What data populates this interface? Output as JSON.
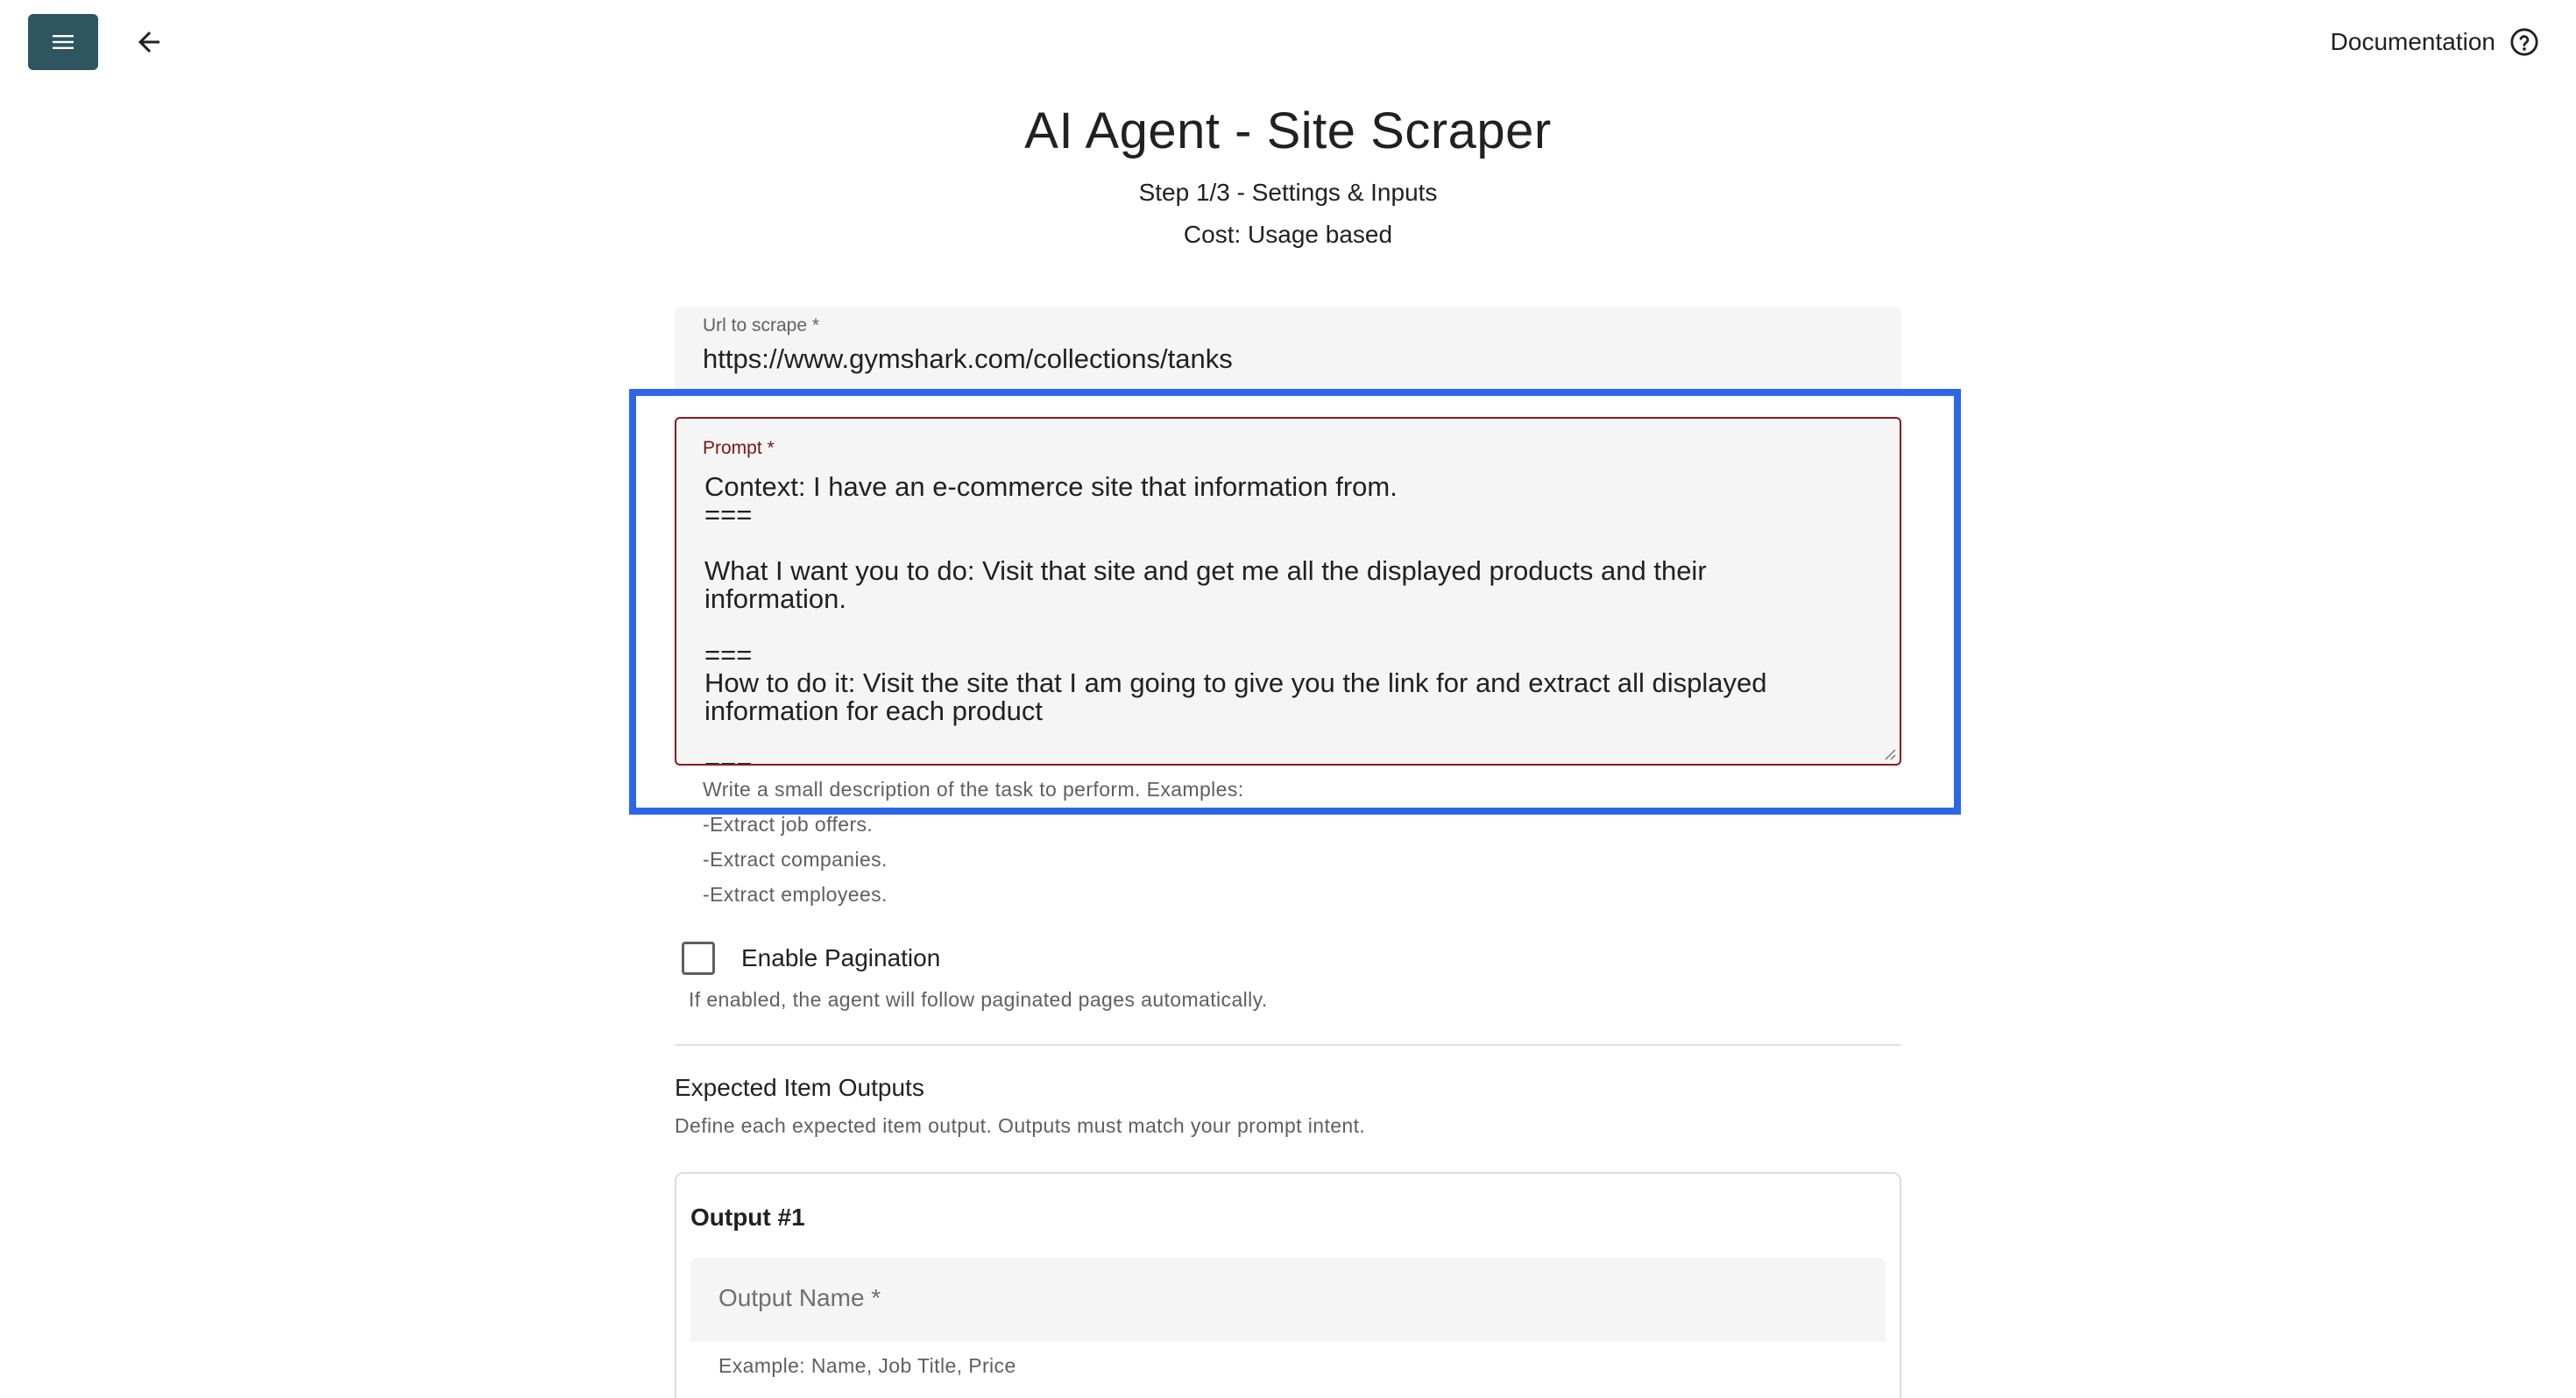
{
  "header": {
    "documentation_label": "Documentation",
    "title": "AI Agent - Site Scraper",
    "step": "Step 1/3 - Settings & Inputs",
    "cost": "Cost: Usage based"
  },
  "url_field": {
    "label": "Url to scrape *",
    "value": "https://www.gymshark.com/collections/tanks"
  },
  "prompt_field": {
    "label": "Prompt *",
    "value": "Context: I have an e-commerce site that information from.\n===\n\nWhat I want you to do: Visit that site and get me all the displayed products and their\ninformation.\n\n===\nHow to do it: Visit the site that I am going to give you the link for and extract all displayed\ninformation for each product\n\n==="
  },
  "prompt_hints": [
    "Write a small description of the task to perform. Examples:",
    "-Extract job offers.",
    "-Extract companies.",
    "-Extract employees."
  ],
  "pagination": {
    "label": "Enable Pagination",
    "checked": false,
    "hint": "If enabled, the agent will follow paginated pages automatically."
  },
  "outputs_section": {
    "title": "Expected Item Outputs",
    "description": "Define each expected item output. Outputs must match your prompt intent.",
    "cards": [
      {
        "title": "Output #1",
        "name_placeholder": "Output Name *",
        "example": "Example: Name, Job Title, Price"
      }
    ]
  },
  "colors": {
    "menu_button": "#2e5560",
    "highlight": "#2e66ea",
    "error_border": "#8a1b1b"
  },
  "icons": {
    "menu": "hamburger-menu-icon",
    "back": "arrow-left-icon",
    "help": "help-circle-icon"
  }
}
